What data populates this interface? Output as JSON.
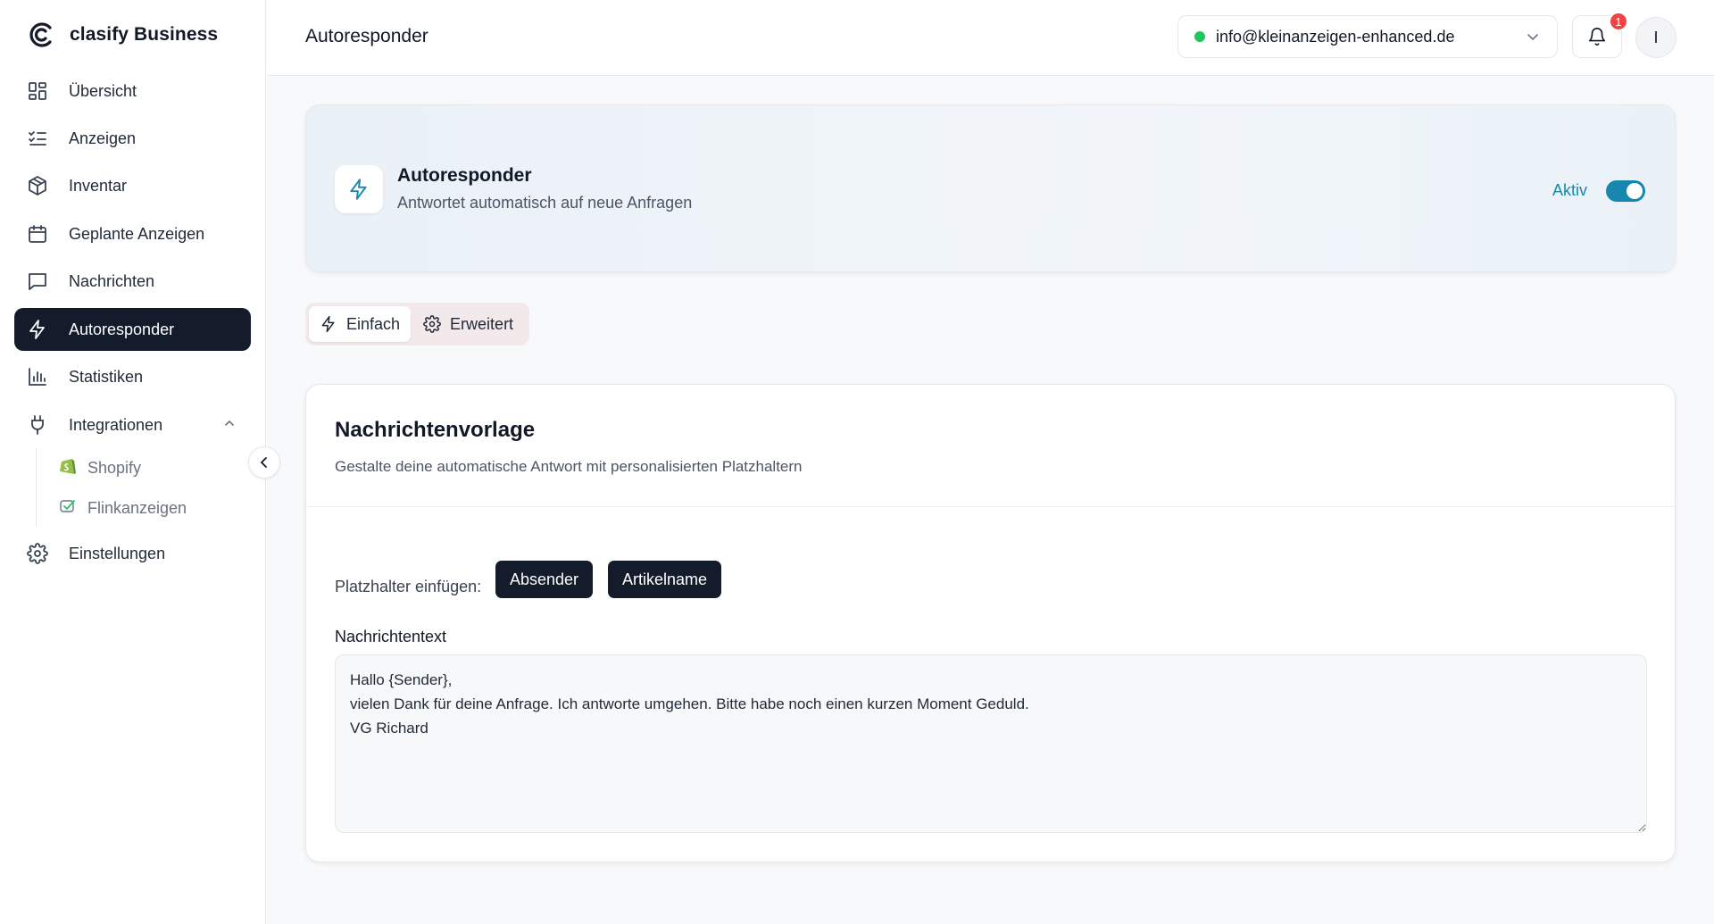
{
  "brand": {
    "name": "clasify Business"
  },
  "sidebar": {
    "items": [
      {
        "label": "Übersicht",
        "icon": "dashboard-icon"
      },
      {
        "label": "Anzeigen",
        "icon": "list-check-icon"
      },
      {
        "label": "Inventar",
        "icon": "box-icon"
      },
      {
        "label": "Geplante Anzeigen",
        "icon": "calendar-icon"
      },
      {
        "label": "Nachrichten",
        "icon": "message-icon"
      },
      {
        "label": "Autoresponder",
        "icon": "lightning-icon",
        "active": true
      },
      {
        "label": "Statistiken",
        "icon": "bar-chart-icon"
      },
      {
        "label": "Integrationen",
        "icon": "plug-icon",
        "expanded": true
      },
      {
        "label": "Einstellungen",
        "icon": "gear-icon"
      }
    ],
    "sub_items": [
      {
        "label": "Shopify",
        "icon": "shopify-icon"
      },
      {
        "label": "Flinkanzeigen",
        "icon": "flinkanzeigen-icon"
      }
    ]
  },
  "header": {
    "title": "Autoresponder",
    "account_email": "info@kleinanzeigen-enhanced.de",
    "notification_count": "1",
    "avatar_initial": "I"
  },
  "hero": {
    "title": "Autoresponder",
    "subtitle": "Antwortet automatisch auf neue Anfragen",
    "status": "Aktiv",
    "enabled": true
  },
  "tabs": [
    {
      "label": "Einfach",
      "icon": "lightning-icon",
      "active": true
    },
    {
      "label": "Erweitert",
      "icon": "gear-icon",
      "active": false
    }
  ],
  "template_card": {
    "title": "Nachrichtenvorlage",
    "subtitle": "Gestalte deine automatische Antwort mit personalisierten Platzhaltern",
    "placeholder_label": "Platzhalter einfügen:",
    "placeholders": [
      "Absender",
      "Artikelname"
    ],
    "message_label": "Nachrichtentext",
    "message_value": "Hallo {Sender},\nvielen Dank für deine Anfrage. Ich antworte umgehen. Bitte habe noch einen kurzen Moment Geduld.\nVG Richard"
  },
  "colors": {
    "accent": "#1787b0",
    "dark": "#141b2b",
    "status_green": "#22c55e",
    "badge_red": "#ef4444"
  }
}
